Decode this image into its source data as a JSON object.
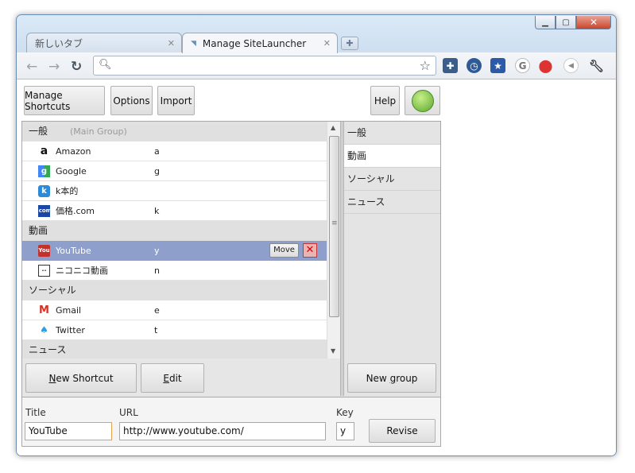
{
  "tabs": [
    {
      "label": "新しいタブ",
      "active": false
    },
    {
      "label": "Manage SiteLauncher",
      "active": true
    }
  ],
  "toolbar": {
    "extensions": [
      "puzzle-icon",
      "clock-icon",
      "star-icon",
      "google-icon",
      "maps-icon",
      "circle-icon",
      "wrench-icon"
    ]
  },
  "topbar": {
    "manage_shortcuts": "Manage Shortcuts",
    "options": "Options",
    "import": "Import",
    "help": "Help"
  },
  "list": {
    "groups": [
      {
        "name": "一般",
        "sub": "(Main Group)",
        "items": [
          {
            "name": "Amazon",
            "key": "a",
            "icon": "amazon-icon"
          },
          {
            "name": "Google",
            "key": "g",
            "icon": "google-icon"
          },
          {
            "name": "k本的",
            "key": "",
            "icon": "k-icon"
          },
          {
            "name": "価格.com",
            "key": "k",
            "icon": "kakaku-icon"
          }
        ]
      },
      {
        "name": "動画",
        "sub": "",
        "items": [
          {
            "name": "YouTube",
            "key": "y",
            "icon": "youtube-icon",
            "selected": true
          },
          {
            "name": "ニコニコ動画",
            "key": "n",
            "icon": "nicovideo-icon"
          }
        ]
      },
      {
        "name": "ソーシャル",
        "sub": "",
        "items": [
          {
            "name": "Gmail",
            "key": "e",
            "icon": "gmail-icon"
          },
          {
            "name": "Twitter",
            "key": "t",
            "icon": "twitter-icon"
          }
        ]
      },
      {
        "name": "ニュース",
        "sub": "",
        "items": []
      }
    ],
    "move_label": "Move"
  },
  "group_panel": {
    "items": [
      "一般",
      "動画",
      "ソーシャル",
      "ニュース"
    ],
    "selected_index": 1
  },
  "buttons": {
    "new_shortcut": "ew Shortcut",
    "new_shortcut_accel": "N",
    "edit": "dit",
    "edit_accel": "E",
    "new_group_a": "New ",
    "new_group_accel": "g",
    "new_group_b": "roup"
  },
  "form": {
    "title_label": "Title",
    "title_value": "YouTube",
    "url_label": "URL",
    "url_value": "http://www.youtube.com/",
    "key_label": "Key",
    "key_value": "y",
    "revise": "Revise"
  }
}
